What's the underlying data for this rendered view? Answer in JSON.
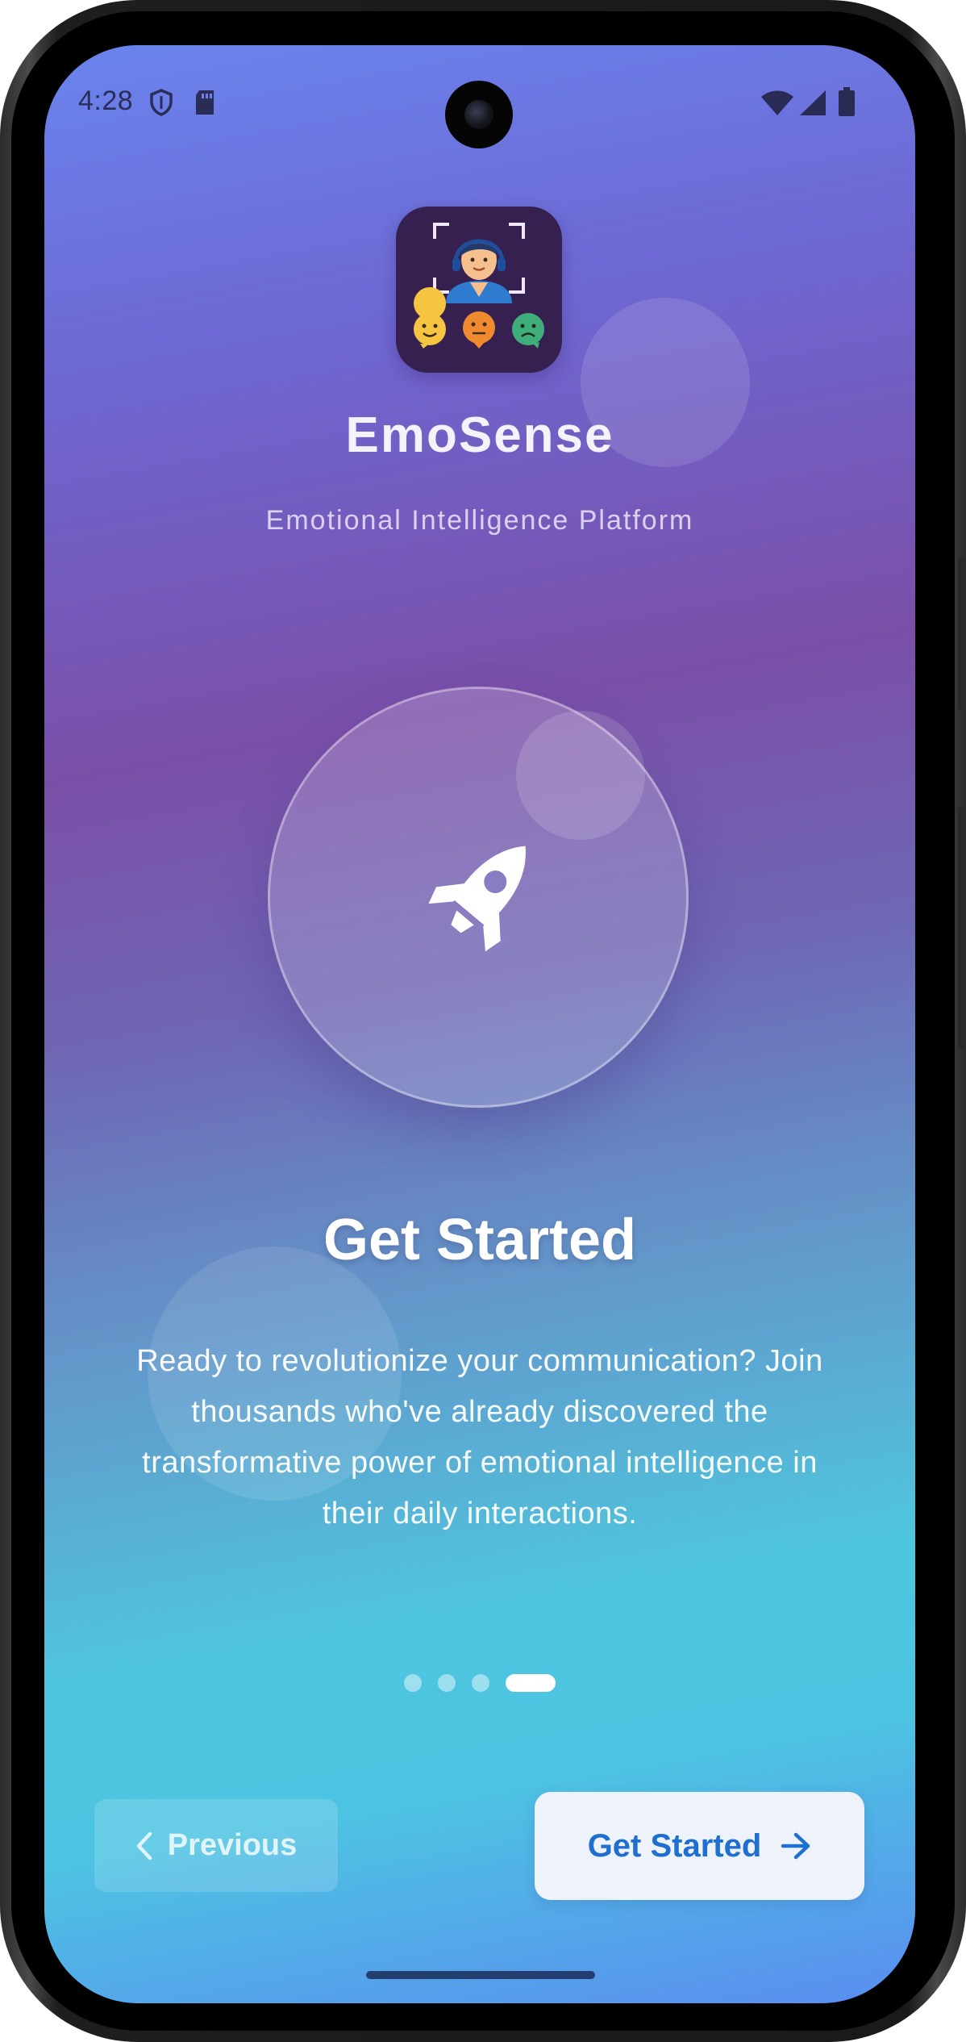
{
  "status_bar": {
    "time": "4:28",
    "left_icons": [
      "shield-icon",
      "sd-card-icon"
    ],
    "right_icons": [
      "wifi-icon",
      "signal-icon",
      "battery-icon"
    ]
  },
  "app": {
    "name": "EmoSense",
    "tagline": "Emotional Intelligence Platform",
    "logo_icon": "agent-with-emotion-faces-icon"
  },
  "slide": {
    "icon": "rocket-icon",
    "title": "Get Started",
    "body": "Ready to revolutionize your communication? Join thousands who've already discovered the transformative power of emotional intelligence in their daily interactions."
  },
  "pager": {
    "total": 4,
    "active_index": 3
  },
  "actions": {
    "previous_label": "Previous",
    "next_label": "Get Started"
  },
  "colors": {
    "gradient_top": "#6a84ee",
    "gradient_mid": "#7a4fa8",
    "gradient_bottom": "#4dc4e2",
    "primary_button_text": "#1f6fd0",
    "primary_button_bg": "#eef2fb"
  }
}
